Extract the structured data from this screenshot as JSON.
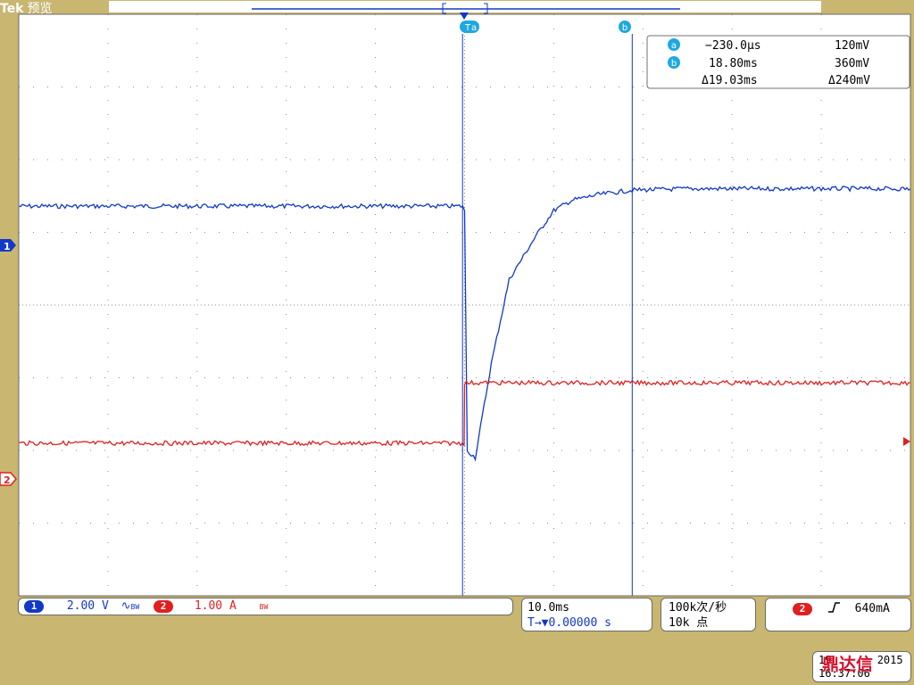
{
  "header": {
    "brand": "Tek",
    "mode": "预览"
  },
  "colors": {
    "ch1": "#1238c8",
    "ch2": "#e02020",
    "background": "#c8b671",
    "grid": "#8c8c8c",
    "cursor_label": "#1ea8e0"
  },
  "cursor_readout": {
    "a_label": "a",
    "a_time": "−230.0µs",
    "a_value": "120mV",
    "b_label": "b",
    "b_time": "18.80ms",
    "b_value": "360mV",
    "delta_time": "Δ19.03ms",
    "delta_value": "Δ240mV"
  },
  "markers": {
    "ch1": "1",
    "ch2": "2",
    "trigger_marker": "T",
    "cursor_a": "a",
    "cursor_b": "b"
  },
  "status": {
    "ch1_scale": "2.00 V",
    "ch1_bw": "BW",
    "ch2_scale": "1.00 A",
    "ch2_bw": "BW",
    "timebase": "10.0ms",
    "position": "T→▼0.00000 s",
    "sample_rate": "100k次/秒",
    "record_length": "10k 点",
    "trigger_source": "2",
    "trigger_slope": "rising-edge-icon",
    "trigger_level": "640mA",
    "date": "19 ",
    "date_suffix": "2015",
    "time": "16:37:06"
  },
  "logo": "鼎达信",
  "chart_data": {
    "type": "line",
    "title": "",
    "xlabel": "",
    "ylabel": "",
    "xlim": [
      -50,
      50
    ],
    "ylim": [
      -4,
      4
    ],
    "grid": true,
    "divisions": [
      10,
      8
    ],
    "cursors": {
      "a": -0.23,
      "b": 18.8
    },
    "series": [
      {
        "channel": "1",
        "unit": "V",
        "scale_per_div": 2.0,
        "x": [
          -50,
          -0.2,
          0,
          0.3,
          1.2,
          3,
          5,
          8,
          10,
          12,
          15,
          18.8,
          25,
          30,
          40,
          50
        ],
        "y": [
          1.36,
          1.36,
          1.28,
          -2.0,
          -2.1,
          -0.8,
          0.35,
          0.95,
          1.3,
          1.44,
          1.52,
          1.58,
          1.6,
          1.6,
          1.6,
          1.6
        ]
      },
      {
        "channel": "2",
        "unit": "A",
        "scale_per_div": 1.0,
        "x": [
          -50,
          -0.05,
          0.0,
          50
        ],
        "y": [
          -1.9,
          -1.9,
          -1.07,
          -1.07
        ]
      }
    ]
  }
}
